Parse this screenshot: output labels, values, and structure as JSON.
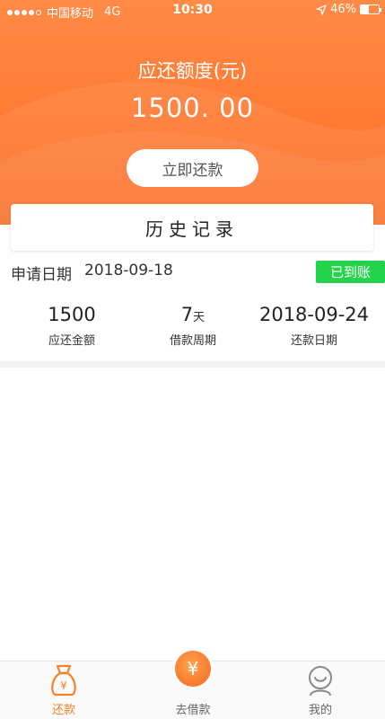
{
  "statusbar": {
    "carrier": "中国移动",
    "network": "4G",
    "time": "10:30",
    "battery": "46%",
    "battery_level": 0.46
  },
  "header": {
    "amount_label": "应还额度(元)",
    "amount_value": "1500. 00",
    "repay_button": "立即还款",
    "history_title": "历史记录"
  },
  "record": {
    "apply_label": "申请日期",
    "apply_date": "2018-09-18",
    "status": "已到账",
    "amount": "1500",
    "amount_label": "应还金额",
    "period": "7",
    "period_unit": "天",
    "period_label": "借款周期",
    "due_date": "2018-09-24",
    "due_label": "还款日期"
  },
  "tabbar": {
    "repay_label": "还款",
    "borrow_label": "去借款",
    "mine_label": "我的",
    "yen": "¥"
  },
  "colors": {
    "brand": "#ff7a33",
    "success": "#22d34b",
    "active_tab": "#f5822b"
  }
}
